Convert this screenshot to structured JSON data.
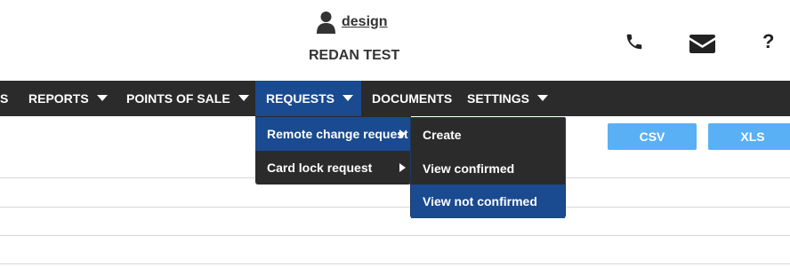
{
  "header": {
    "username": "design",
    "company": "REDAN TEST",
    "icons": {
      "user": "user-icon",
      "phone": "phone-icon",
      "mail": "mail-icon",
      "help": "help-icon"
    },
    "help_glyph": "?"
  },
  "nav": {
    "partial_item": "S",
    "items": [
      {
        "label": "REPORTS"
      },
      {
        "label": "POINTS OF SALE"
      },
      {
        "label": "REQUESTS"
      },
      {
        "label": "DOCUMENTS"
      },
      {
        "label": "SETTINGS"
      }
    ],
    "active": "REQUESTS"
  },
  "requests_menu": {
    "items": [
      {
        "label": "Remote change request"
      },
      {
        "label": "Card lock request"
      }
    ]
  },
  "remote_change_submenu": {
    "items": [
      {
        "label": "Create"
      },
      {
        "label": "View confirmed"
      },
      {
        "label": "View not confirmed"
      }
    ]
  },
  "export": {
    "csv_label": "CSV",
    "xls_label": "XLS"
  },
  "colors": {
    "navbar_bg": "#2b2b2b",
    "active_bg": "#1a4a8f",
    "button_bg": "#5ab0f5"
  }
}
